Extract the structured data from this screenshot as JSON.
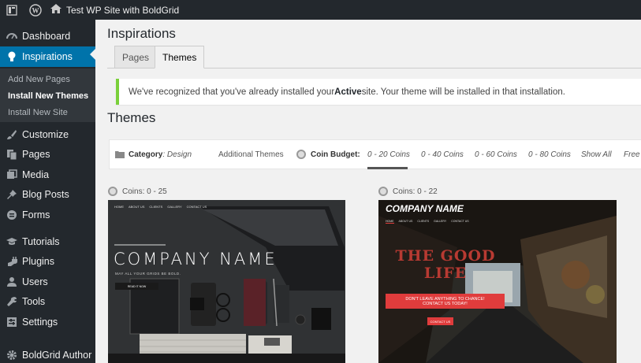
{
  "adminbar": {
    "site_name": "Test WP Site with BoldGrid"
  },
  "sidebar": {
    "items": [
      {
        "label": "Dashboard"
      },
      {
        "label": "Inspirations"
      },
      {
        "label": "Customize"
      },
      {
        "label": "Pages"
      },
      {
        "label": "Media"
      },
      {
        "label": "Blog Posts"
      },
      {
        "label": "Forms"
      },
      {
        "label": "Tutorials"
      },
      {
        "label": "Plugins"
      },
      {
        "label": "Users"
      },
      {
        "label": "Tools"
      },
      {
        "label": "Settings"
      },
      {
        "label": "BoldGrid Author"
      }
    ],
    "submenu": [
      {
        "label": "Add New Pages"
      },
      {
        "label": "Install New Themes"
      },
      {
        "label": "Install New Site"
      }
    ]
  },
  "main": {
    "title": "Inspirations",
    "tabs": [
      {
        "label": "Pages"
      },
      {
        "label": "Themes"
      }
    ],
    "notice": {
      "before": "We've recognized that you've already installed your ",
      "bold": "Active",
      "after": " site. Your theme will be installed in that installation."
    },
    "section_title": "Themes",
    "filter": {
      "category_label": "Category",
      "category_value": ": Design",
      "additional": "Additional Themes",
      "budget_label": "Coin Budget:",
      "budgets": [
        "0 - 20 Coins",
        "0 - 40 Coins",
        "0 - 60 Coins",
        "0 - 80 Coins",
        "Show All",
        "Free"
      ]
    },
    "themes": [
      {
        "coins": "Coins: 0 - 25",
        "nav": [
          "HOME",
          "ABOUT US",
          "CLIENTS",
          "GALLERY",
          "CONTACT US"
        ],
        "company": "COMPANY NAME",
        "tagline": "MAY ALL YOUR GRIDS BE BOLD.",
        "button": "READ IT NOW"
      },
      {
        "coins": "Coins: 0 - 22",
        "nav": [
          "HOME",
          "ABOUT US",
          "CLIENTS",
          "GALLERY",
          "CONTACT US"
        ],
        "company": "COMPANY NAME",
        "graffiti": "THE GOOD LIFE",
        "banner_line1": "DON'T LEAVE ANYTHING TO CHANCE!",
        "banner_line2": "CONTACT US TODAY!",
        "button": "CONTACT US"
      }
    ]
  },
  "colors": {
    "admin_dark": "#23282d",
    "accent": "#0073aa",
    "notice_green": "#7ad03a",
    "theme_red": "#e03c3c"
  }
}
